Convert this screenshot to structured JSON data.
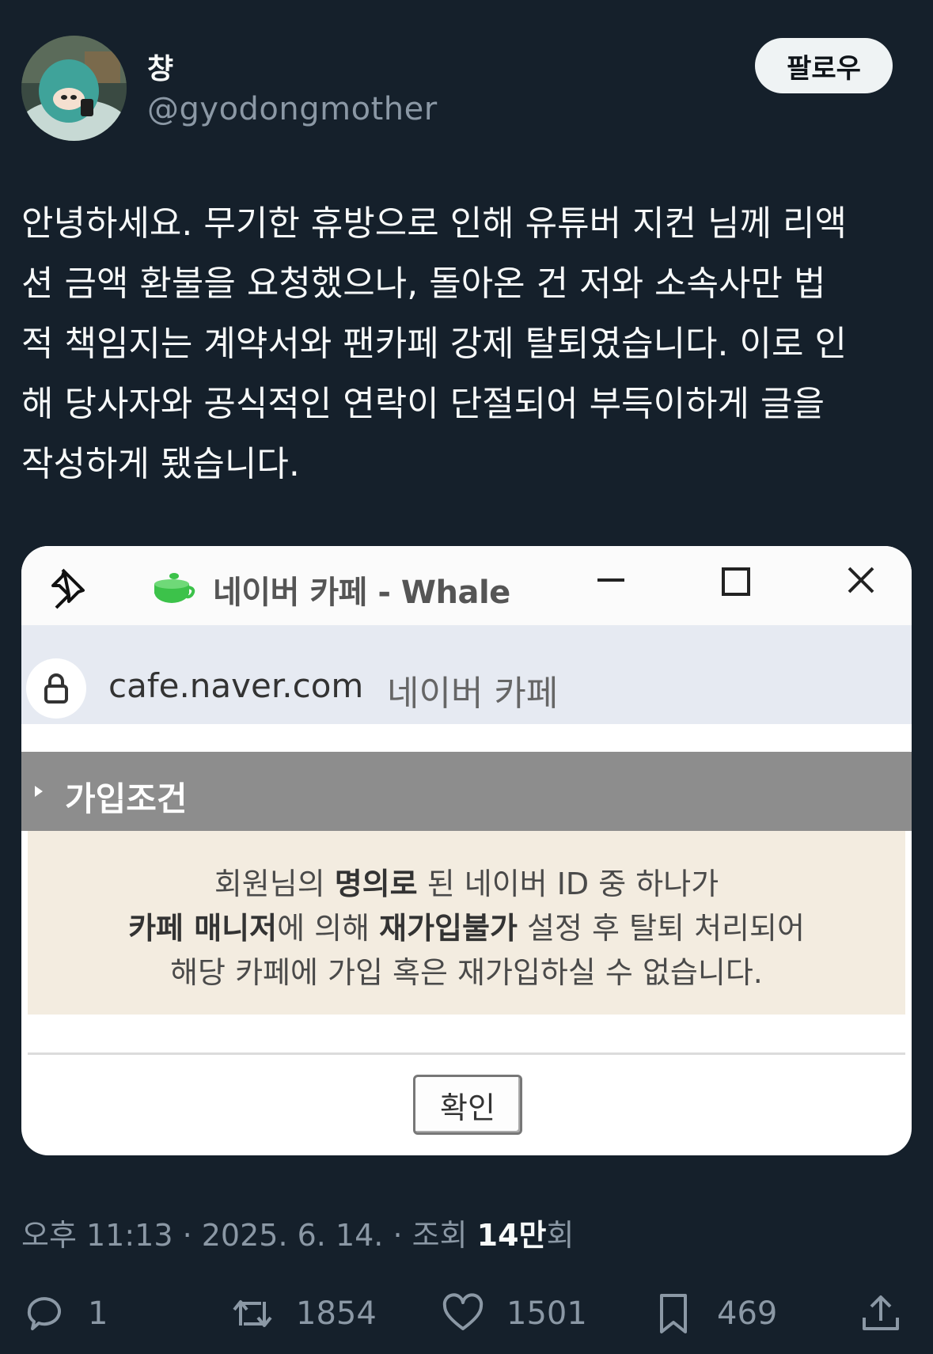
{
  "user": {
    "display_name": "챵",
    "handle": "@gyodongmother",
    "follow_label": "팔로우"
  },
  "tweet": {
    "text": "안녕하세요. 무기한 휴방으로 인해 유튜버 지컨 님께 리액\n션 금액 환불을 요청했으나, 돌아온 건 저와 소속사만 법\n적 책임지는 계약서와 팬카페 강제 탈퇴였습니다. 이로 인\n해 당사자와 공식적인 연락이 단절되어 부득이하게 글을\n작성하게 됐습니다."
  },
  "media": {
    "window_title": "네이버 카페 - Whale",
    "url": "cafe.naver.com",
    "page_title": "네이버 카페",
    "section_title": "가입조건",
    "notice": {
      "line1_a": "회원님의 ",
      "line1_b": "명의로",
      "line1_c": " 된 네이버 ID 중 하나가",
      "line2_a": "카페 매니저",
      "line2_b": "에 의해 ",
      "line2_c": "재가입불가",
      "line2_d": " 설정 후 탈퇴 처리되어",
      "line3": "해당 카페에 가입 혹은 재가입하실 수 없습니다."
    },
    "ok_label": "확인"
  },
  "meta": {
    "time": "오후 11:13 · 2025. 6. 14. · 조회 ",
    "views": "14만",
    "views_suffix": "회"
  },
  "actions": {
    "replies": "1",
    "retweets": "1854",
    "likes": "1501",
    "bookmarks": "469"
  }
}
